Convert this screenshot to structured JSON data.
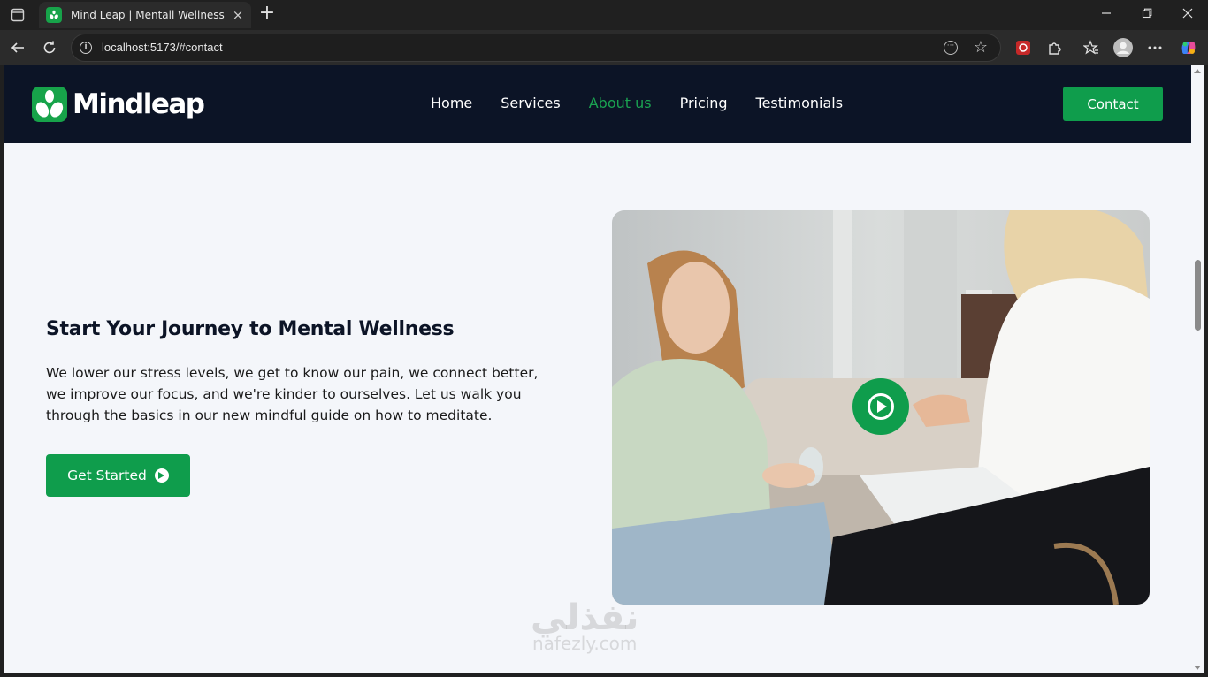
{
  "browser": {
    "tab_title": "Mind Leap | Mentall Wellness Rea",
    "url": "localhost:5173/#contact",
    "tab_close": "×",
    "new_tab": "+"
  },
  "site": {
    "brand": "Mindleap",
    "nav": [
      "Home",
      "Services",
      "About us",
      "Pricing",
      "Testimonials"
    ],
    "active_nav": "About us",
    "contact_label": "Contact"
  },
  "hero": {
    "title": "Start Your Journey to Mental Wellness",
    "body": "We lower our stress levels, we get to know our pain, we connect better, we improve our focus, and we're kinder to ourselves. Let us walk you through the basics in our new mindful guide on how to meditate.",
    "cta_label": "Get Started"
  },
  "watermark": {
    "arabic": "نفذلي",
    "latin": "nafezly.com"
  },
  "colors": {
    "brand_green": "#0f9d4c",
    "nav_bg": "#0c1426",
    "page_bg": "#f4f6fa"
  }
}
